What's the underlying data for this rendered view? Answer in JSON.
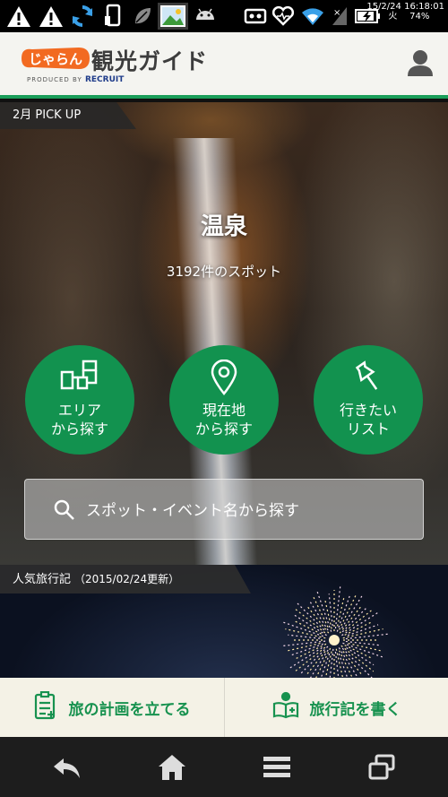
{
  "status_bar": {
    "date": "15/2/24",
    "time": "16:18:01",
    "weekday": "火",
    "battery": "74%",
    "icons": [
      "warning-icon",
      "warning-icon",
      "sync-icon",
      "phone-icon",
      "leaf-icon",
      "gallery-icon",
      "android-icon",
      "mail-icon",
      "heart-icon",
      "wifi-icon",
      "signal-icon",
      "battery-icon"
    ]
  },
  "header": {
    "logo_text": "じゃらん",
    "title": "観光ガイド",
    "produced_by": "PRODUCED BY",
    "company": "RECRUIT",
    "icons": [
      "avatar-icon"
    ]
  },
  "hero": {
    "pickup_label": "2月 PICK UP",
    "title": "温泉",
    "count": "3192件のスポット",
    "buttons": [
      {
        "line1": "エリア",
        "line2": "から探す",
        "icon": "area-map-icon"
      },
      {
        "line1": "現在地",
        "line2": "から探す",
        "icon": "location-pin-icon"
      },
      {
        "line1": "行きたい",
        "line2": "リスト",
        "icon": "pushpin-icon"
      }
    ],
    "search_placeholder": "スポット・イベント名から探す"
  },
  "travelogue": {
    "label": "人気旅行記",
    "updated": "（2015/02/24更新）"
  },
  "actions": {
    "plan": "旅の計画を立てる",
    "write": "旅行記を書く"
  },
  "nav": {
    "icons": [
      "back-icon",
      "home-icon",
      "menu-icon",
      "recent-apps-icon"
    ]
  },
  "colors": {
    "brand_green": "#12924f",
    "header_bg": "#f4f4f0",
    "logo_orange": "#f26a21"
  }
}
